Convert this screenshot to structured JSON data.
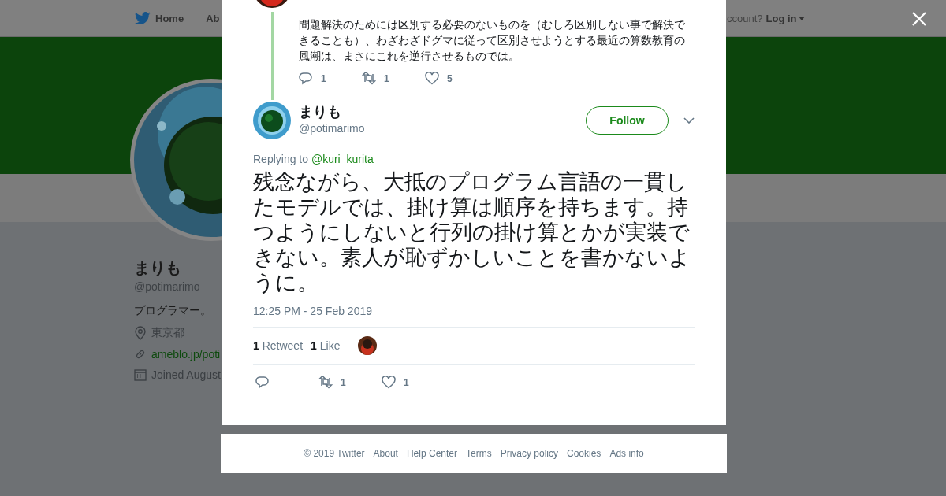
{
  "nav": {
    "items": [
      "Home",
      "Ab"
    ],
    "login_prompt": "ccount?",
    "login": "Log in"
  },
  "profile": {
    "name": "まりも",
    "handle": "@potimarimo",
    "bio": "プログラマー。",
    "location": "東京都",
    "url": "ameblo.jp/poti",
    "joined": "Joined August"
  },
  "parent_tweet": {
    "text": "問題解決のためには区別する必要のないものを（むしろ区別しない事で解決できることも）、わざわざドグマに従って区別させようとする最近の算数教育の風潮は、まさにこれを逆行させるものでは。",
    "replies": "1",
    "retweets": "1",
    "likes": "5"
  },
  "tweet": {
    "name": "まりも",
    "handle": "@potimarimo",
    "follow": "Follow",
    "replying_to": "Replying to",
    "reply_user": "@kuri_kurita",
    "text": "残念ながら、大抵のプログラム言語の一貫したモデルでは、掛け算は順序を持ちます。持つようにしないと行列の掛け算とかが実装できない。素人が恥ずかしいことを書かないように。",
    "time": "12:25 PM - 25 Feb 2019",
    "retweet_count": "1",
    "retweet_label": "Retweet",
    "like_count": "1",
    "like_label": "Like",
    "retweets": "1",
    "likes": "1"
  },
  "footer": [
    "© 2019 Twitter",
    "About",
    "Help Center",
    "Terms",
    "Privacy policy",
    "Cookies",
    "Ads info"
  ]
}
